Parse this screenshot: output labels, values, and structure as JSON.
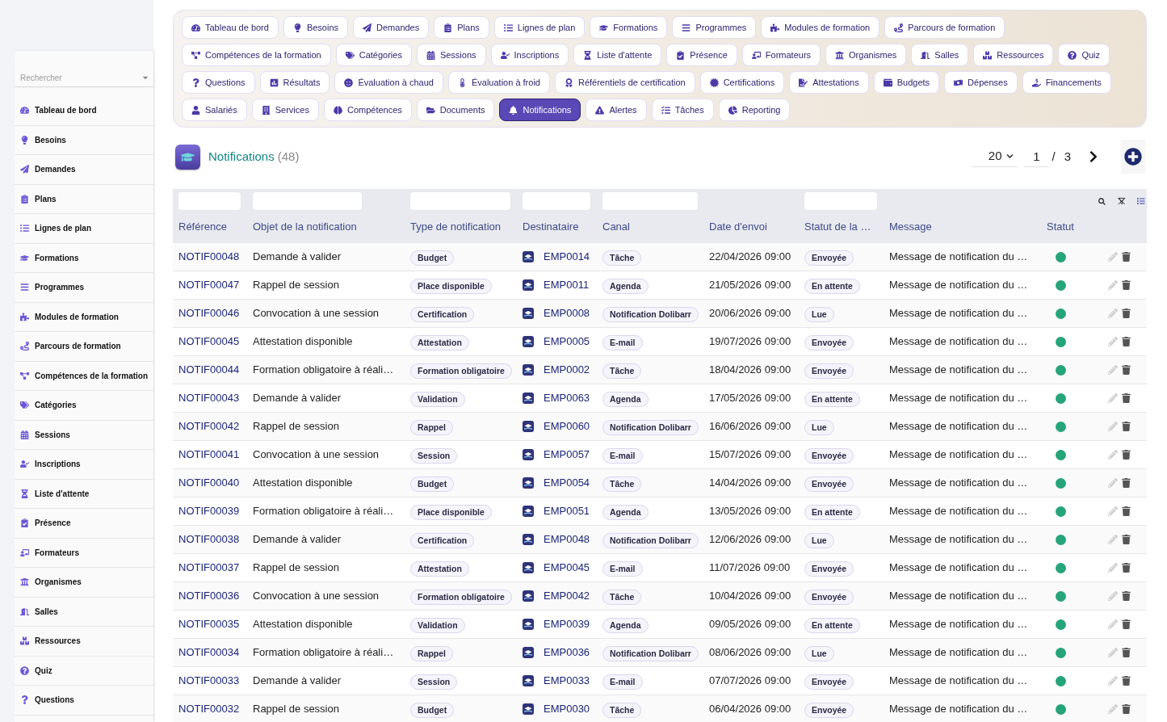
{
  "sidebar": {
    "search": {
      "placeholder": "Rechercher"
    },
    "items": [
      "Tableau de bord",
      "Besoins",
      "Demandes",
      "Plans",
      "Lignes de plan",
      "Formations",
      "Programmes",
      "Modules de formation",
      "Parcours de formation",
      "Compétences de la formation",
      "Catégories",
      "Sessions",
      "Inscriptions",
      "Liste d'attente",
      "Présence",
      "Formateurs",
      "Organismes",
      "Salles",
      "Ressources",
      "Quiz",
      "Questions"
    ]
  },
  "nav_tabs": [
    {
      "label": "Tableau de bord",
      "selected": false
    },
    {
      "label": "Besoins",
      "selected": false
    },
    {
      "label": "Demandes",
      "selected": false
    },
    {
      "label": "Plans",
      "selected": false
    },
    {
      "label": "Lignes de plan",
      "selected": false
    },
    {
      "label": "Formations",
      "selected": false
    },
    {
      "label": "Programmes",
      "selected": false
    },
    {
      "label": "Modules de formation",
      "selected": false
    },
    {
      "label": "Parcours de formation",
      "selected": false
    },
    {
      "label": "Compétences de la formation",
      "selected": false
    },
    {
      "label": "Catégories",
      "selected": false
    },
    {
      "label": "Sessions",
      "selected": false
    },
    {
      "label": "Inscriptions",
      "selected": false
    },
    {
      "label": "Liste d'attente",
      "selected": false
    },
    {
      "label": "Présence",
      "selected": false
    },
    {
      "label": "Formateurs",
      "selected": false
    },
    {
      "label": "Organismes",
      "selected": false
    },
    {
      "label": "Salles",
      "selected": false
    },
    {
      "label": "Ressources",
      "selected": false
    },
    {
      "label": "Quiz",
      "selected": false
    },
    {
      "label": "Questions",
      "selected": false
    },
    {
      "label": "Résultats",
      "selected": false
    },
    {
      "label": "Évaluation à chaud",
      "selected": false
    },
    {
      "label": "Évaluation à froid",
      "selected": false
    },
    {
      "label": "Référentiels de certification",
      "selected": false
    },
    {
      "label": "Certifications",
      "selected": false
    },
    {
      "label": "Attestations",
      "selected": false
    },
    {
      "label": "Budgets",
      "selected": false
    },
    {
      "label": "Dépenses",
      "selected": false
    },
    {
      "label": "Financements",
      "selected": false
    },
    {
      "label": "Salariés",
      "selected": false
    },
    {
      "label": "Services",
      "selected": false
    },
    {
      "label": "Compétences",
      "selected": false
    },
    {
      "label": "Documents",
      "selected": false
    },
    {
      "label": "Notifications",
      "selected": true
    },
    {
      "label": "Alertes",
      "selected": false
    },
    {
      "label": "Tâches",
      "selected": false
    },
    {
      "label": "Reporting",
      "selected": false
    }
  ],
  "header": {
    "title": "Notifications",
    "count": "(48)",
    "page_size": "20",
    "page": "1",
    "separator": "/",
    "page_count": "3"
  },
  "table": {
    "columns": [
      {
        "label": "Référence",
        "filter": true
      },
      {
        "label": "Objet de la notification",
        "filter": true
      },
      {
        "label": "Type de notification",
        "filter": true
      },
      {
        "label": "Destinataire",
        "filter": true
      },
      {
        "label": "Canal",
        "filter": true
      },
      {
        "label": "Date d'envoi",
        "filter": false
      },
      {
        "label": "Statut de la …",
        "filter": true
      },
      {
        "label": "Message",
        "filter": false
      },
      {
        "label": "Statut",
        "filter": false
      }
    ],
    "rows": [
      {
        "reference": "NOTIF00048",
        "subject": "Demande à valider",
        "type": "Budget",
        "recipient": "EMP0014",
        "channel": "Tâche",
        "date": "22/04/2026 09:00",
        "state": "Envoyée",
        "message": "Message de notification du …",
        "color": "#26a47a"
      },
      {
        "reference": "NOTIF00047",
        "subject": "Rappel de session",
        "type": "Place disponible",
        "recipient": "EMP0011",
        "channel": "Agenda",
        "date": "21/05/2026 09:00",
        "state": "En attente",
        "message": "Message de notification du …",
        "color": "#26a47a"
      },
      {
        "reference": "NOTIF00046",
        "subject": "Convocation à une session",
        "type": "Certification",
        "recipient": "EMP0008",
        "channel": "Notification Dolibarr",
        "date": "20/06/2026 09:00",
        "state": "Lue",
        "message": "Message de notification du …",
        "color": "#26a47a"
      },
      {
        "reference": "NOTIF00045",
        "subject": "Attestation disponible",
        "type": "Attestation",
        "recipient": "EMP0005",
        "channel": "E-mail",
        "date": "19/07/2026 09:00",
        "state": "Envoyée",
        "message": "Message de notification du …",
        "color": "#26a47a"
      },
      {
        "reference": "NOTIF00044",
        "subject": "Formation obligatoire à réali…",
        "type": "Formation obligatoire",
        "recipient": "EMP0002",
        "channel": "Tâche",
        "date": "18/04/2026 09:00",
        "state": "Envoyée",
        "message": "Message de notification du …",
        "color": "#26a47a"
      },
      {
        "reference": "NOTIF00043",
        "subject": "Demande à valider",
        "type": "Validation",
        "recipient": "EMP0063",
        "channel": "Agenda",
        "date": "17/05/2026 09:00",
        "state": "En attente",
        "message": "Message de notification du …",
        "color": "#26a47a"
      },
      {
        "reference": "NOTIF00042",
        "subject": "Rappel de session",
        "type": "Rappel",
        "recipient": "EMP0060",
        "channel": "Notification Dolibarr",
        "date": "16/06/2026 09:00",
        "state": "Lue",
        "message": "Message de notification du …",
        "color": "#26a47a"
      },
      {
        "reference": "NOTIF00041",
        "subject": "Convocation à une session",
        "type": "Session",
        "recipient": "EMP0057",
        "channel": "E-mail",
        "date": "15/07/2026 09:00",
        "state": "Envoyée",
        "message": "Message de notification du …",
        "color": "#26a47a"
      },
      {
        "reference": "NOTIF00040",
        "subject": "Attestation disponible",
        "type": "Budget",
        "recipient": "EMP0054",
        "channel": "Tâche",
        "date": "14/04/2026 09:00",
        "state": "Envoyée",
        "message": "Message de notification du …",
        "color": "#26a47a"
      },
      {
        "reference": "NOTIF00039",
        "subject": "Formation obligatoire à réali…",
        "type": "Place disponible",
        "recipient": "EMP0051",
        "channel": "Agenda",
        "date": "13/05/2026 09:00",
        "state": "En attente",
        "message": "Message de notification du …",
        "color": "#26a47a"
      },
      {
        "reference": "NOTIF00038",
        "subject": "Demande à valider",
        "type": "Certification",
        "recipient": "EMP0048",
        "channel": "Notification Dolibarr",
        "date": "12/06/2026 09:00",
        "state": "Lue",
        "message": "Message de notification du …",
        "color": "#26a47a"
      },
      {
        "reference": "NOTIF00037",
        "subject": "Rappel de session",
        "type": "Attestation",
        "recipient": "EMP0045",
        "channel": "E-mail",
        "date": "11/07/2026 09:00",
        "state": "Envoyée",
        "message": "Message de notification du …",
        "color": "#26a47a"
      },
      {
        "reference": "NOTIF00036",
        "subject": "Convocation à une session",
        "type": "Formation obligatoire",
        "recipient": "EMP0042",
        "channel": "Tâche",
        "date": "10/04/2026 09:00",
        "state": "Envoyée",
        "message": "Message de notification du …",
        "color": "#26a47a"
      },
      {
        "reference": "NOTIF00035",
        "subject": "Attestation disponible",
        "type": "Validation",
        "recipient": "EMP0039",
        "channel": "Agenda",
        "date": "09/05/2026 09:00",
        "state": "En attente",
        "message": "Message de notification du …",
        "color": "#26a47a"
      },
      {
        "reference": "NOTIF00034",
        "subject": "Formation obligatoire à réali…",
        "type": "Rappel",
        "recipient": "EMP0036",
        "channel": "Notification Dolibarr",
        "date": "08/06/2026 09:00",
        "state": "Lue",
        "message": "Message de notification du …",
        "color": "#26a47a"
      },
      {
        "reference": "NOTIF00033",
        "subject": "Demande à valider",
        "type": "Session",
        "recipient": "EMP0033",
        "channel": "E-mail",
        "date": "07/07/2026 09:00",
        "state": "Envoyée",
        "message": "Message de notification du …",
        "color": "#26a47a"
      },
      {
        "reference": "NOTIF00032",
        "subject": "Rappel de session",
        "type": "Budget",
        "recipient": "EMP0030",
        "channel": "Tâche",
        "date": "06/04/2026 09:00",
        "state": "Envoyée",
        "message": "Message de notification du …",
        "color": "#26a47a"
      }
    ]
  }
}
